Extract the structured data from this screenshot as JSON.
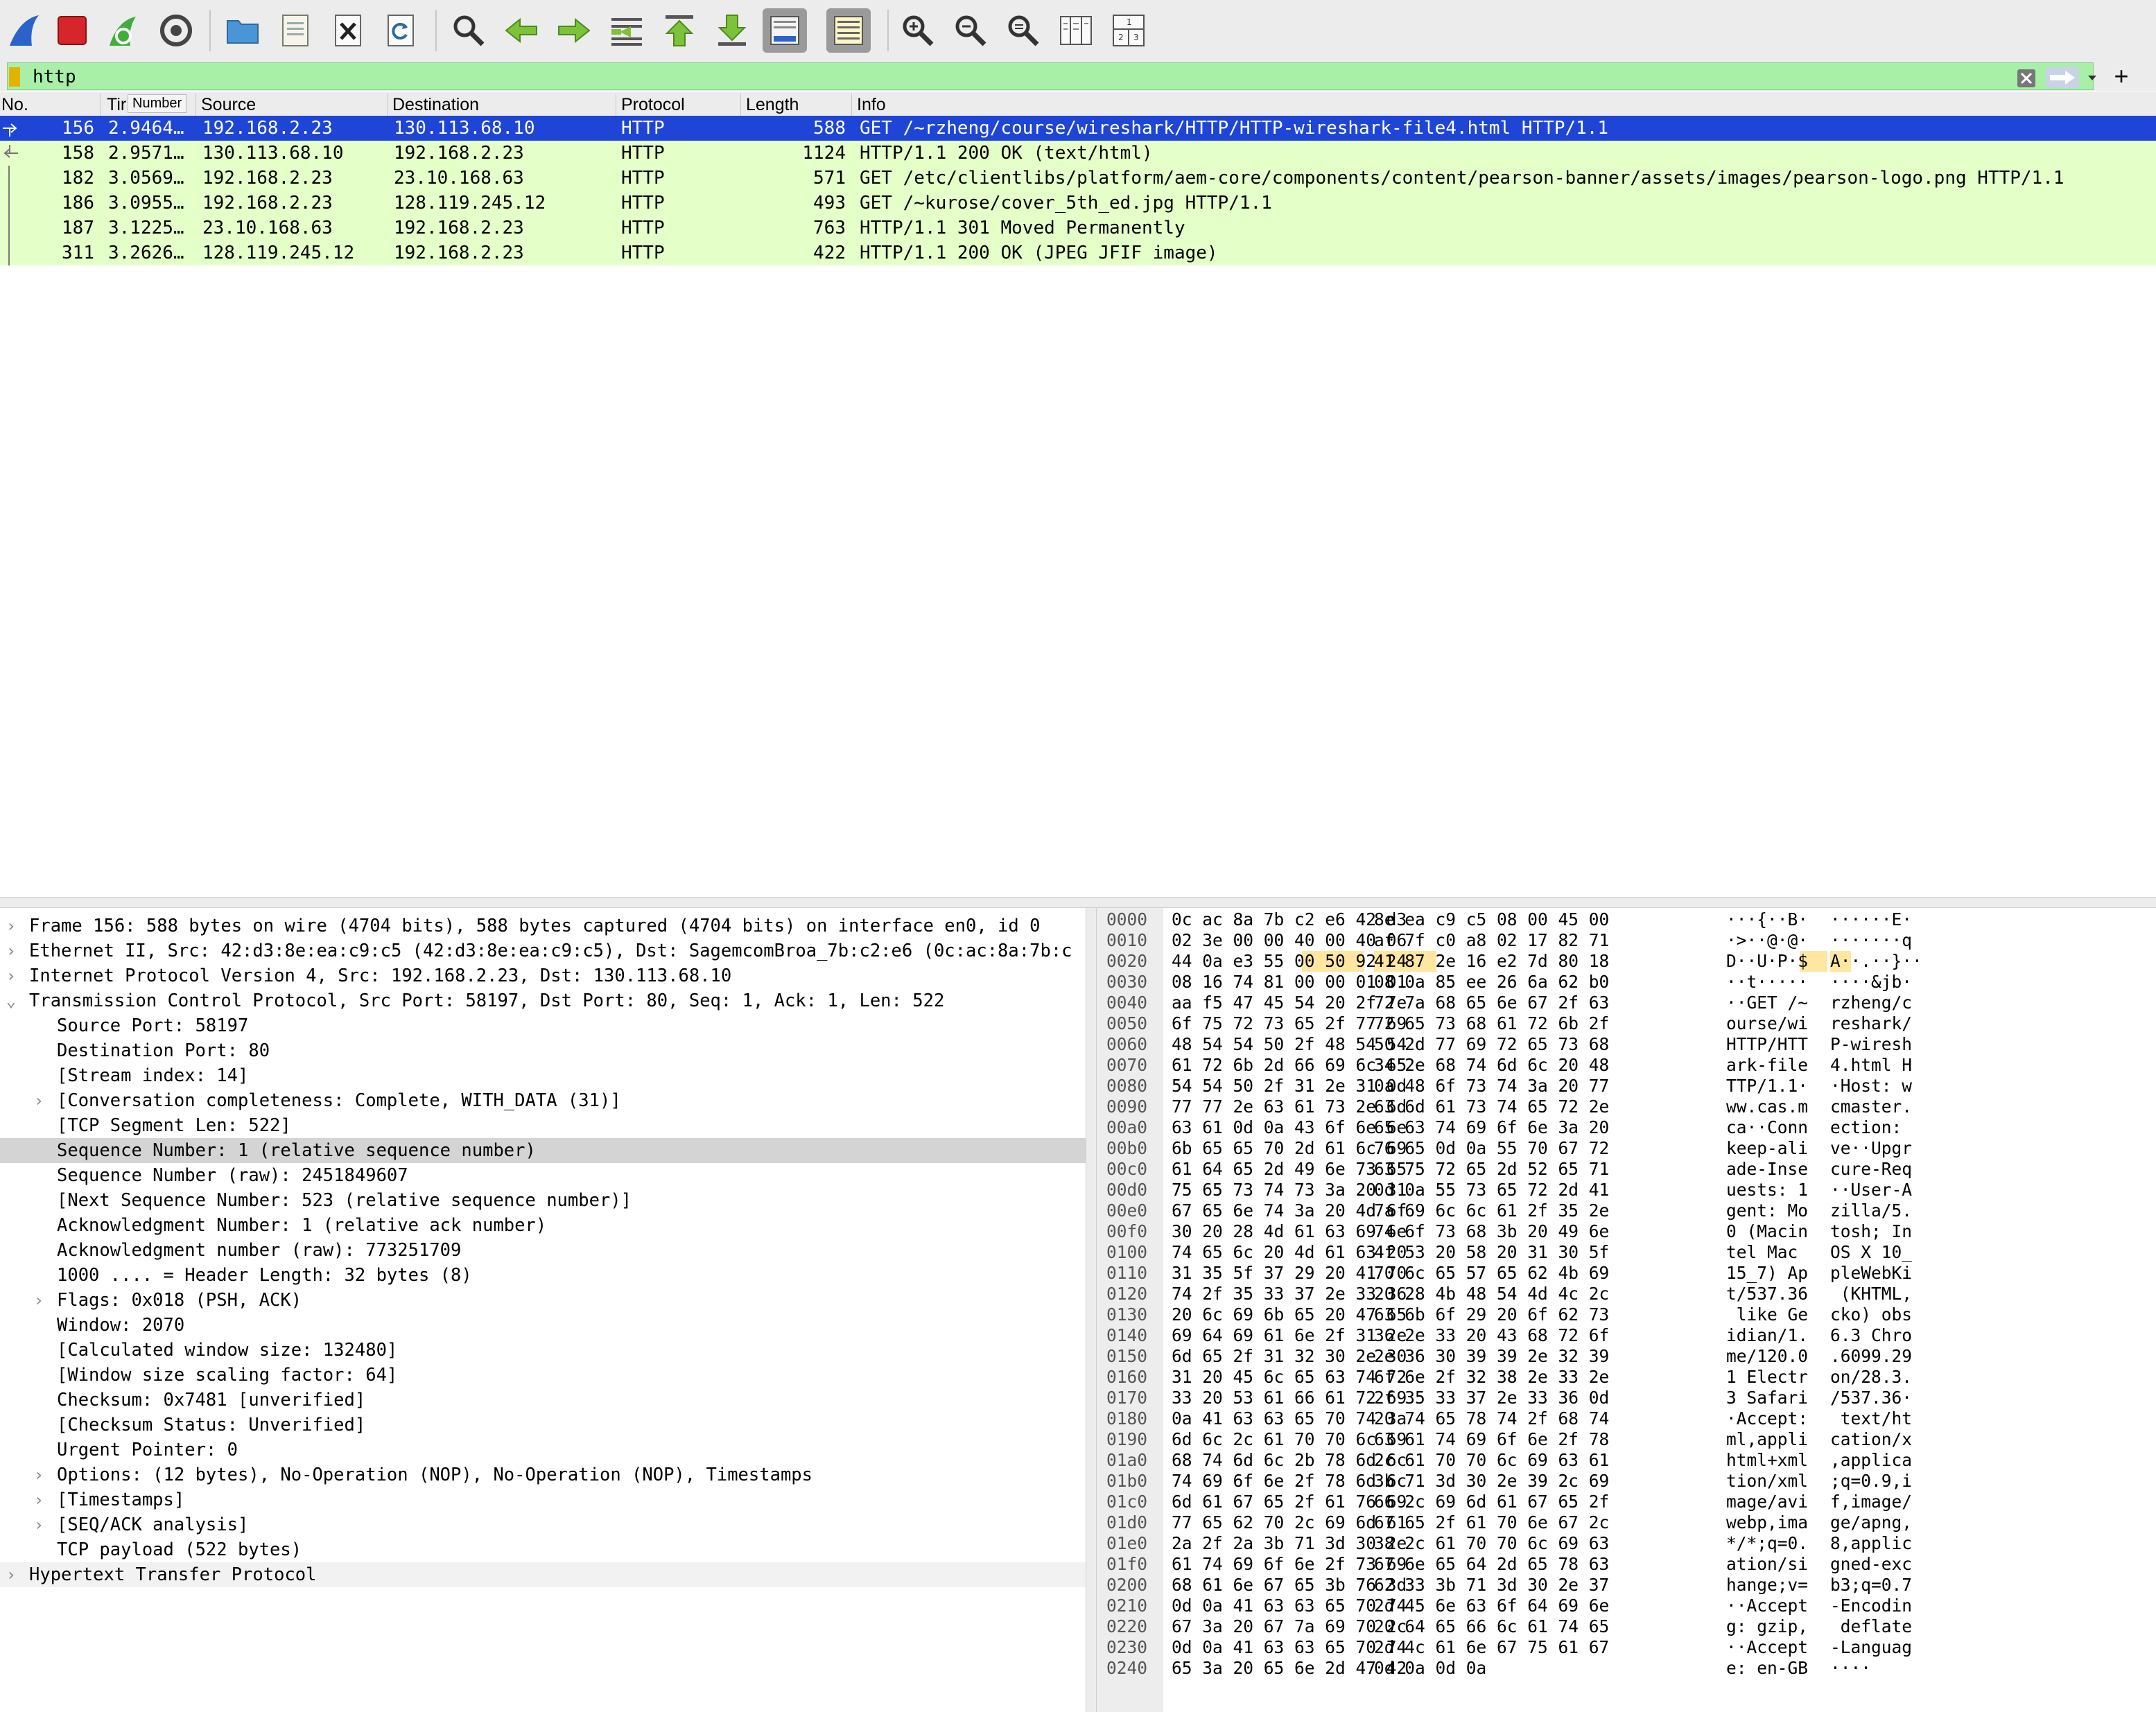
{
  "toolbar": {
    "icons": [
      "shark-fin-start-icon",
      "stop-capture-icon",
      "restart-capture-icon",
      "capture-options-icon",
      "open-file-icon",
      "save-file-icon",
      "close-file-icon",
      "reload-file-icon",
      "find-packet-icon",
      "go-back-icon",
      "go-forward-icon",
      "go-to-packet-icon",
      "go-first-icon",
      "go-last-icon",
      "autoscroll-icon",
      "colorize-icon",
      "zoom-in-icon",
      "zoom-out-icon",
      "normal-size-icon",
      "resize-columns-icon",
      "layout-icon"
    ]
  },
  "filter": {
    "text": "http",
    "plus": "+"
  },
  "packet_list": {
    "columns": [
      "No.",
      "Tir",
      "Source",
      "Destination",
      "Protocol",
      "Length",
      "Info"
    ],
    "tooltip": "Number",
    "rows": [
      {
        "no": "156",
        "time": "2.9464…",
        "src": "192.168.2.23",
        "dst": "130.113.68.10",
        "proto": "HTTP",
        "len": "588",
        "info": "GET /~rzheng/course/wireshark/HTTP/HTTP-wireshark-file4.html HTTP/1.1"
      },
      {
        "no": "158",
        "time": "2.9571…",
        "src": "130.113.68.10",
        "dst": "192.168.2.23",
        "proto": "HTTP",
        "len": "1124",
        "info": "HTTP/1.1 200 OK  (text/html)"
      },
      {
        "no": "182",
        "time": "3.0569…",
        "src": "192.168.2.23",
        "dst": "23.10.168.63",
        "proto": "HTTP",
        "len": "571",
        "info": "GET /etc/clientlibs/platform/aem-core/components/content/pearson-banner/assets/images/pearson-logo.png HTTP/1.1"
      },
      {
        "no": "186",
        "time": "3.0955…",
        "src": "192.168.2.23",
        "dst": "128.119.245.12",
        "proto": "HTTP",
        "len": "493",
        "info": "GET /~kurose/cover_5th_ed.jpg HTTP/1.1"
      },
      {
        "no": "187",
        "time": "3.1225…",
        "src": "23.10.168.63",
        "dst": "192.168.2.23",
        "proto": "HTTP",
        "len": "763",
        "info": "HTTP/1.1 301 Moved Permanently"
      },
      {
        "no": "311",
        "time": "3.2626…",
        "src": "128.119.245.12",
        "dst": "192.168.2.23",
        "proto": "HTTP",
        "len": "422",
        "info": "HTTP/1.1 200 OK  (JPEG JFIF image)"
      }
    ],
    "colors": {
      "selected": "#1f45d6",
      "http": "#e4ffc7"
    }
  },
  "details": {
    "rows": [
      {
        "indent": 0,
        "exp": ">",
        "text": "Frame 156: 588 bytes on wire (4704 bits), 588 bytes captured (4704 bits) on interface en0, id 0"
      },
      {
        "indent": 0,
        "exp": ">",
        "text": "Ethernet II, Src: 42:d3:8e:ea:c9:c5 (42:d3:8e:ea:c9:c5), Dst: SagemcomBroa_7b:c2:e6 (0c:ac:8a:7b:c"
      },
      {
        "indent": 0,
        "exp": ">",
        "text": "Internet Protocol Version 4, Src: 192.168.2.23, Dst: 130.113.68.10"
      },
      {
        "indent": 0,
        "exp": "v",
        "text": "Transmission Control Protocol, Src Port: 58197, Dst Port: 80, Seq: 1, Ack: 1, Len: 522"
      },
      {
        "indent": 1,
        "exp": "",
        "text": "Source Port: 58197"
      },
      {
        "indent": 1,
        "exp": "",
        "text": "Destination Port: 80"
      },
      {
        "indent": 1,
        "exp": "",
        "text": "[Stream index: 14]"
      },
      {
        "indent": 1,
        "exp": ">",
        "text": "[Conversation completeness: Complete, WITH_DATA (31)]"
      },
      {
        "indent": 1,
        "exp": "",
        "text": "[TCP Segment Len: 522]"
      },
      {
        "indent": 1,
        "exp": "",
        "text": "Sequence Number: 1    (relative sequence number)"
      },
      {
        "indent": 1,
        "exp": "",
        "text": "Sequence Number (raw): 2451849607"
      },
      {
        "indent": 1,
        "exp": "",
        "text": "[Next Sequence Number: 523    (relative sequence number)]"
      },
      {
        "indent": 1,
        "exp": "",
        "text": "Acknowledgment Number: 1    (relative ack number)"
      },
      {
        "indent": 1,
        "exp": "",
        "text": "Acknowledgment number (raw): 773251709"
      },
      {
        "indent": 1,
        "exp": "",
        "text": "1000 .... = Header Length: 32 bytes (8)"
      },
      {
        "indent": 1,
        "exp": ">",
        "text": "Flags: 0x018 (PSH, ACK)"
      },
      {
        "indent": 1,
        "exp": "",
        "text": "Window: 2070"
      },
      {
        "indent": 1,
        "exp": "",
        "text": "[Calculated window size: 132480]"
      },
      {
        "indent": 1,
        "exp": "",
        "text": "[Window size scaling factor: 64]"
      },
      {
        "indent": 1,
        "exp": "",
        "text": "Checksum: 0x7481 [unverified]"
      },
      {
        "indent": 1,
        "exp": "",
        "text": "[Checksum Status: Unverified]"
      },
      {
        "indent": 1,
        "exp": "",
        "text": "Urgent Pointer: 0"
      },
      {
        "indent": 1,
        "exp": ">",
        "text": "Options: (12 bytes), No-Operation (NOP), No-Operation (NOP), Timestamps"
      },
      {
        "indent": 1,
        "exp": ">",
        "text": "[Timestamps]"
      },
      {
        "indent": 1,
        "exp": ">",
        "text": "[SEQ/ACK analysis]"
      },
      {
        "indent": 1,
        "exp": "",
        "text": "TCP payload (522 bytes)"
      },
      {
        "indent": 0,
        "exp": ">",
        "text": "Hypertext Transfer Protocol"
      }
    ],
    "selected_index": 9
  },
  "bytes": {
    "rows": [
      {
        "off": "0000",
        "h1": "0c ac 8a 7b c2 e6 42 d3",
        "h2": "8e ea c9 c5 08 00 45 00",
        "a1": "···{··B·",
        "a2": "······E·"
      },
      {
        "off": "0010",
        "h1": "02 3e 00 00 40 00 40 06",
        "h2": "af 7f c0 a8 02 17 82 71",
        "a1": "·>··@·@·",
        "a2": "·······q"
      },
      {
        "off": "0020",
        "h1": "44 0a e3 55 00 50 92 24",
        "h2": "41 87 2e 16 e2 7d 80 18",
        "a1": "D··U·P·$",
        "a2": "A··.··}··"
      },
      {
        "off": "0030",
        "h1": "08 16 74 81 00 00 01 01",
        "h2": "08 0a 85 ee 26 6a 62 b0",
        "a1": "··t·····",
        "a2": "····&jb·"
      },
      {
        "off": "0040",
        "h1": "aa f5 47 45 54 20 2f 7e",
        "h2": "72 7a 68 65 6e 67 2f 63",
        "a1": "··GET /~",
        "a2": "rzheng/c"
      },
      {
        "off": "0050",
        "h1": "6f 75 72 73 65 2f 77 69",
        "h2": "72 65 73 68 61 72 6b 2f",
        "a1": "ourse/wi",
        "a2": "reshark/"
      },
      {
        "off": "0060",
        "h1": "48 54 54 50 2f 48 54 54",
        "h2": "50 2d 77 69 72 65 73 68",
        "a1": "HTTP/HTT",
        "a2": "P-wiresh"
      },
      {
        "off": "0070",
        "h1": "61 72 6b 2d 66 69 6c 65",
        "h2": "34 2e 68 74 6d 6c 20 48",
        "a1": "ark-file",
        "a2": "4.html H"
      },
      {
        "off": "0080",
        "h1": "54 54 50 2f 31 2e 31 0d",
        "h2": "0a 48 6f 73 74 3a 20 77",
        "a1": "TTP/1.1·",
        "a2": "·Host: w"
      },
      {
        "off": "0090",
        "h1": "77 77 2e 63 61 73 2e 6d",
        "h2": "63 6d 61 73 74 65 72 2e",
        "a1": "ww.cas.m",
        "a2": "cmaster."
      },
      {
        "off": "00a0",
        "h1": "63 61 0d 0a 43 6f 6e 6e",
        "h2": "65 63 74 69 6f 6e 3a 20",
        "a1": "ca··Conn",
        "a2": "ection: "
      },
      {
        "off": "00b0",
        "h1": "6b 65 65 70 2d 61 6c 69",
        "h2": "76 65 0d 0a 55 70 67 72",
        "a1": "keep-ali",
        "a2": "ve··Upgr"
      },
      {
        "off": "00c0",
        "h1": "61 64 65 2d 49 6e 73 65",
        "h2": "63 75 72 65 2d 52 65 71",
        "a1": "ade-Inse",
        "a2": "cure-Req"
      },
      {
        "off": "00d0",
        "h1": "75 65 73 74 73 3a 20 31",
        "h2": "0d 0a 55 73 65 72 2d 41",
        "a1": "uests: 1",
        "a2": "··User-A"
      },
      {
        "off": "00e0",
        "h1": "67 65 6e 74 3a 20 4d 6f",
        "h2": "7a 69 6c 6c 61 2f 35 2e",
        "a1": "gent: Mo",
        "a2": "zilla/5."
      },
      {
        "off": "00f0",
        "h1": "30 20 28 4d 61 63 69 6e",
        "h2": "74 6f 73 68 3b 20 49 6e",
        "a1": "0 (Macin",
        "a2": "tosh; In"
      },
      {
        "off": "0100",
        "h1": "74 65 6c 20 4d 61 63 20",
        "h2": "4f 53 20 58 20 31 30 5f",
        "a1": "tel Mac ",
        "a2": "OS X 10_"
      },
      {
        "off": "0110",
        "h1": "31 35 5f 37 29 20 41 70",
        "h2": "70 6c 65 57 65 62 4b 69",
        "a1": "15_7) Ap",
        "a2": "pleWebKi"
      },
      {
        "off": "0120",
        "h1": "74 2f 35 33 37 2e 33 36",
        "h2": "20 28 4b 48 54 4d 4c 2c",
        "a1": "t/537.36",
        "a2": " (KHTML,"
      },
      {
        "off": "0130",
        "h1": "20 6c 69 6b 65 20 47 65",
        "h2": "63 6b 6f 29 20 6f 62 73",
        "a1": " like Ge",
        "a2": "cko) obs"
      },
      {
        "off": "0140",
        "h1": "69 64 69 61 6e 2f 31 2e",
        "h2": "36 2e 33 20 43 68 72 6f",
        "a1": "idian/1.",
        "a2": "6.3 Chro"
      },
      {
        "off": "0150",
        "h1": "6d 65 2f 31 32 30 2e 30",
        "h2": "2e 36 30 39 39 2e 32 39",
        "a1": "me/120.0",
        "a2": ".6099.29"
      },
      {
        "off": "0160",
        "h1": "31 20 45 6c 65 63 74 72",
        "h2": "6f 6e 2f 32 38 2e 33 2e",
        "a1": "1 Electr",
        "a2": "on/28.3."
      },
      {
        "off": "0170",
        "h1": "33 20 53 61 66 61 72 69",
        "h2": "2f 35 33 37 2e 33 36 0d",
        "a1": "3 Safari",
        "a2": "/537.36·"
      },
      {
        "off": "0180",
        "h1": "0a 41 63 63 65 70 74 3a",
        "h2": "20 74 65 78 74 2f 68 74",
        "a1": "·Accept:",
        "a2": " text/ht"
      },
      {
        "off": "0190",
        "h1": "6d 6c 2c 61 70 70 6c 69",
        "h2": "63 61 74 69 6f 6e 2f 78",
        "a1": "ml,appli",
        "a2": "cation/x"
      },
      {
        "off": "01a0",
        "h1": "68 74 6d 6c 2b 78 6d 6c",
        "h2": "2c 61 70 70 6c 69 63 61",
        "a1": "html+xml",
        "a2": ",applica"
      },
      {
        "off": "01b0",
        "h1": "74 69 6f 6e 2f 78 6d 6c",
        "h2": "3b 71 3d 30 2e 39 2c 69",
        "a1": "tion/xml",
        "a2": ";q=0.9,i"
      },
      {
        "off": "01c0",
        "h1": "6d 61 67 65 2f 61 76 69",
        "h2": "66 2c 69 6d 61 67 65 2f",
        "a1": "mage/avi",
        "a2": "f,image/"
      },
      {
        "off": "01d0",
        "h1": "77 65 62 70 2c 69 6d 61",
        "h2": "67 65 2f 61 70 6e 67 2c",
        "a1": "webp,ima",
        "a2": "ge/apng,"
      },
      {
        "off": "01e0",
        "h1": "2a 2f 2a 3b 71 3d 30 2e",
        "h2": "38 2c 61 70 70 6c 69 63",
        "a1": "*/*;q=0.",
        "a2": "8,applic"
      },
      {
        "off": "01f0",
        "h1": "61 74 69 6f 6e 2f 73 69",
        "h2": "67 6e 65 64 2d 65 78 63",
        "a1": "ation/si",
        "a2": "gned-exc"
      },
      {
        "off": "0200",
        "h1": "68 61 6e 67 65 3b 76 3d",
        "h2": "62 33 3b 71 3d 30 2e 37",
        "a1": "hange;v=",
        "a2": "b3;q=0.7"
      },
      {
        "off": "0210",
        "h1": "0d 0a 41 63 63 65 70 74",
        "h2": "2d 45 6e 63 6f 64 69 6e",
        "a1": "··Accept",
        "a2": "-Encodin"
      },
      {
        "off": "0220",
        "h1": "67 3a 20 67 7a 69 70 2c",
        "h2": "20 64 65 66 6c 61 74 65",
        "a1": "g: gzip,",
        "a2": " deflate"
      },
      {
        "off": "0230",
        "h1": "0d 0a 41 63 63 65 70 74",
        "h2": "2d 4c 61 6e 67 75 61 67",
        "a1": "··Accept",
        "a2": "-Languag"
      },
      {
        "off": "0240",
        "h1": "65 3a 20 65 6e 2d 47 42",
        "h2": "0d 0a 0d 0a",
        "a1": "e: en-GB",
        "a2": "····"
      }
    ],
    "highlight_color": "#ffe7a2"
  }
}
